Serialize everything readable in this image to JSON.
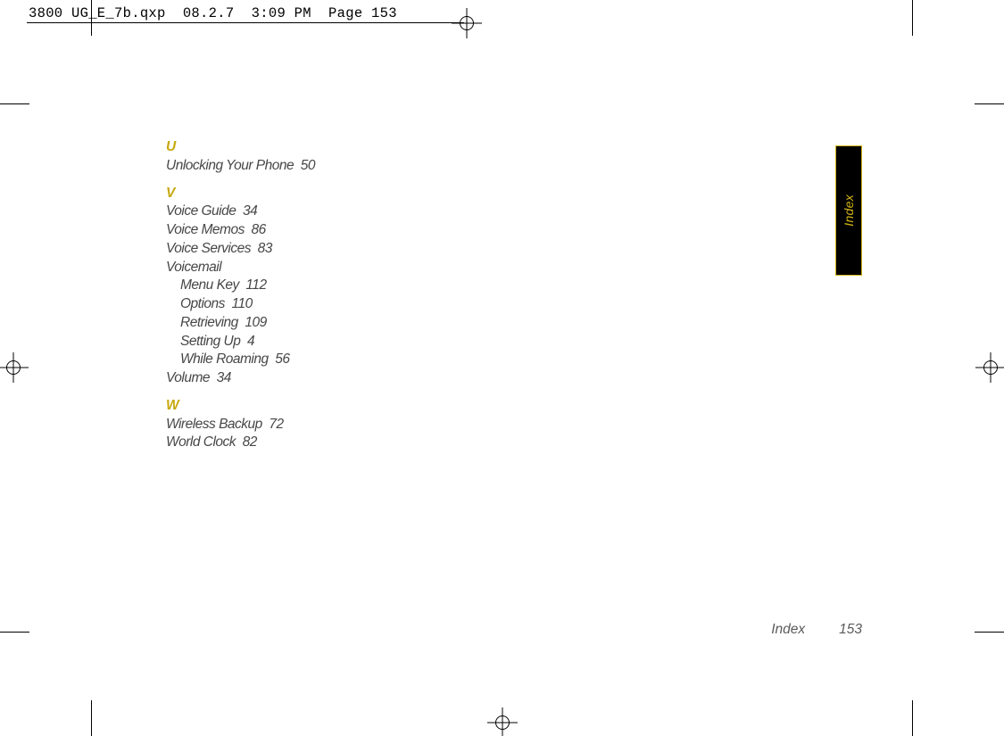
{
  "slug": "3800 UG_E_7b.qxp  08.2.7  3:09 PM  Page 153",
  "side_tab": "Index",
  "footer": {
    "label": "Index",
    "page_number": "153"
  },
  "index": {
    "U": {
      "letter": "U",
      "entries": [
        {
          "label": "Unlocking Your Phone",
          "page": "50"
        }
      ]
    },
    "V": {
      "letter": "V",
      "entries": [
        {
          "label": "Voice Guide",
          "page": "34"
        },
        {
          "label": "Voice Memos",
          "page": "86"
        },
        {
          "label": "Voice Services",
          "page": "83"
        },
        {
          "label": "Voicemail",
          "page": "",
          "sub": [
            {
              "label": "Menu Key",
              "page": "112"
            },
            {
              "label": "Options",
              "page": "110"
            },
            {
              "label": "Retrieving",
              "page": "109"
            },
            {
              "label": "Setting Up",
              "page": "4"
            },
            {
              "label": "While Roaming",
              "page": "56"
            }
          ]
        },
        {
          "label": "Volume",
          "page": "34"
        }
      ]
    },
    "W": {
      "letter": "W",
      "entries": [
        {
          "label": "Wireless Backup",
          "page": "72"
        },
        {
          "label": "World Clock",
          "page": "82"
        }
      ]
    }
  }
}
